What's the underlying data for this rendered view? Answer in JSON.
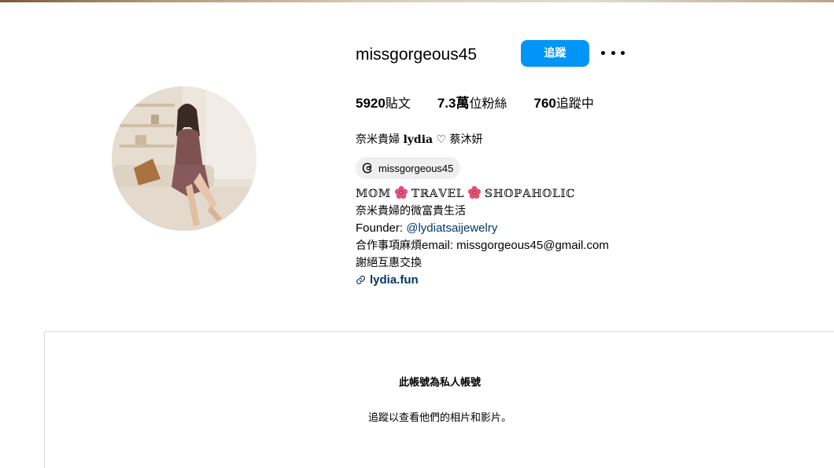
{
  "profile": {
    "username": "missgorgeous45",
    "follow_label": "追蹤",
    "more_icon": "more-horizontal-icon",
    "avatar_icon": "profile-photo"
  },
  "stats": {
    "posts_count": "5920",
    "posts_label": "貼文",
    "followers_count": "7.3萬",
    "followers_label": "位粉絲",
    "following_count": "760",
    "following_label": "追蹤中"
  },
  "bio": {
    "name_prefix": "奈米貴婦 ",
    "name_fancy": "𝐥𝐲𝐝𝐢𝐚",
    "name_suffix": " ♡ 蔡沐妍",
    "threads_icon": "threads-icon",
    "threads_handle": "missgorgeous45",
    "line1_a": "𝕄𝕆𝕄",
    "line1_b": "𝕋ℝ𝔸𝕍𝔼𝕃",
    "line1_c": "𝕊ℍ𝕆ℙ𝔸ℍ𝕆𝕃𝕀ℂ",
    "flower_icon": "hibiscus-icon",
    "line2": "奈米貴婦的微富貴生活",
    "line3_prefix": "Founder: ",
    "line3_link": "@lydiatsaijewelry",
    "line4_prefix": "合作事項麻煩",
    "line4_rest": "email: missgorgeous45@gmail.com",
    "line5": "謝絕互惠交換",
    "link_icon": "link-icon",
    "website": "lydia.fun"
  },
  "private_section": {
    "title": "此帳號為私人帳號",
    "subtitle": "追蹤以查看他們的相片和影片。"
  },
  "colors": {
    "accent": "#0095f6",
    "link": "#00376b",
    "chip_bg": "#efefef",
    "border": "#dbdbdb"
  }
}
